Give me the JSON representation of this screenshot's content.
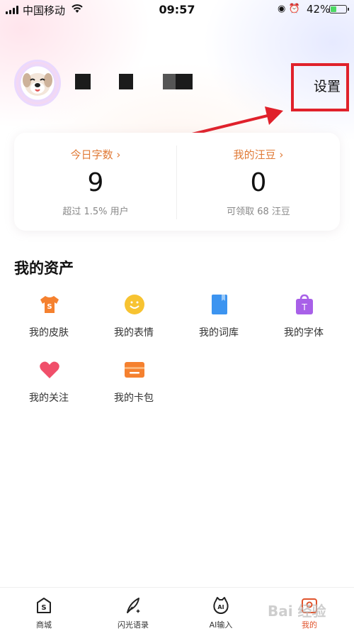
{
  "status_bar": {
    "carrier": "中国移动",
    "time": "09:57",
    "battery": "42%",
    "battery_level": 0.42
  },
  "profile": {
    "settings_label": "设置"
  },
  "stats": {
    "today": {
      "label": "今日字数 ›",
      "value": "9",
      "sub": "超过 1.5% 用户"
    },
    "beans": {
      "label": "我的汪豆 ›",
      "value": "0",
      "sub": "可领取 68 汪豆"
    }
  },
  "assets": {
    "title": "我的资产",
    "items": [
      {
        "label": "我的皮肤",
        "icon": "shirt-icon",
        "color": "#f5812f"
      },
      {
        "label": "我的表情",
        "icon": "smile-icon",
        "color": "#f7c331"
      },
      {
        "label": "我的词库",
        "icon": "book-icon",
        "color": "#3c94f0"
      },
      {
        "label": "我的字体",
        "icon": "shopping-bag-icon",
        "color": "#a860e8"
      },
      {
        "label": "我的关注",
        "icon": "heart-icon",
        "color": "#f04f6a"
      },
      {
        "label": "我的卡包",
        "icon": "wallet-icon",
        "color": "#f5812f"
      }
    ]
  },
  "nav": {
    "items": [
      {
        "label": "商城",
        "icon": "store-icon"
      },
      {
        "label": "闪光语录",
        "icon": "quill-icon"
      },
      {
        "label": "AI输入",
        "icon": "ai-icon"
      },
      {
        "label": "我的",
        "icon": "profile-icon",
        "active": true
      }
    ]
  },
  "watermark": "Bai 经验"
}
